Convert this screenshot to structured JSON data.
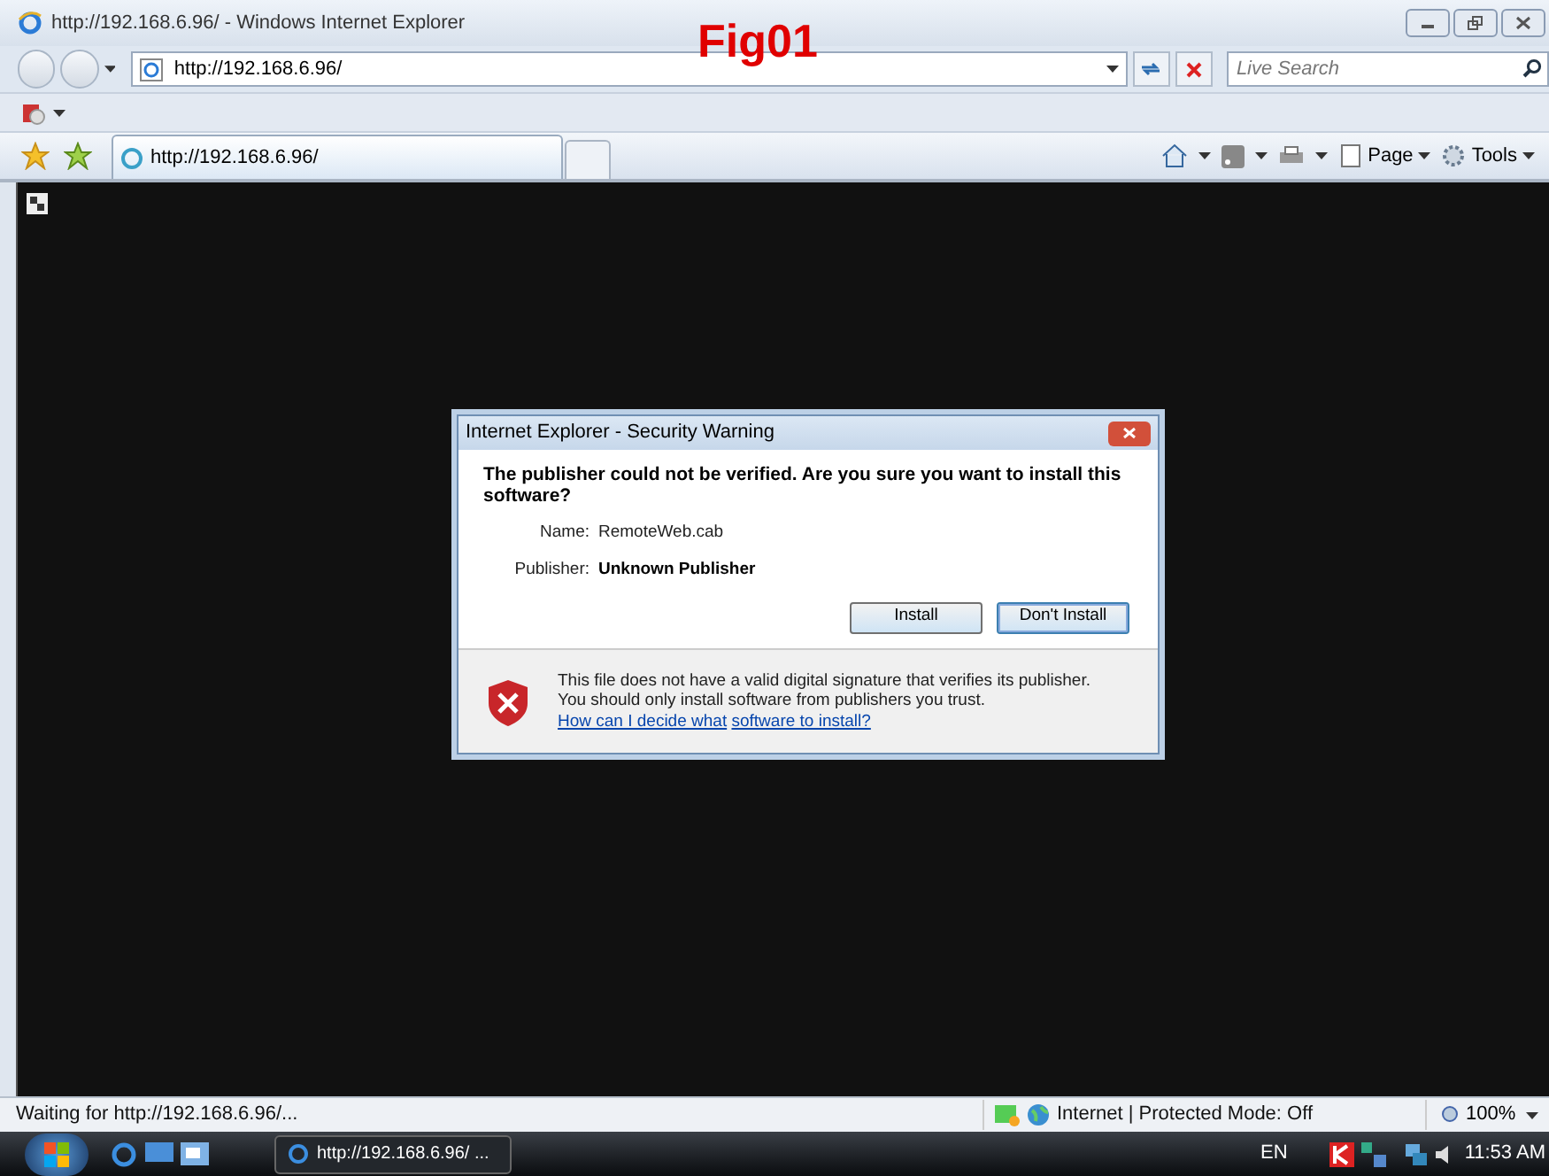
{
  "window": {
    "title": "http://192.168.6.96/ - Windows Internet Explorer"
  },
  "figure_label": "Fig01",
  "address_bar": {
    "url": "http://192.168.6.96/"
  },
  "search": {
    "placeholder": "Live Search"
  },
  "tabs": [
    {
      "label": "http://192.168.6.96/",
      "selected": true
    }
  ],
  "command_bar": [
    {
      "label": "Page"
    },
    {
      "label": "Tools"
    }
  ],
  "dialog": {
    "title": "Internet Explorer - Security Warning",
    "question": "The publisher could not be verified.  Are you sure you want to install this software?",
    "fields": [
      {
        "label": "Name:",
        "value": "RemoteWeb.cab",
        "bold": false
      },
      {
        "label": "Publisher:",
        "value": "Unknown Publisher",
        "bold": true
      }
    ],
    "buttons": [
      {
        "label": "Install",
        "selected": false
      },
      {
        "label": "Don't Install",
        "selected": true
      }
    ],
    "warning": "This file does not have a valid digital signature that verifies its publisher. You should only install software from publishers you trust.",
    "help_link": [
      "How can I decide what",
      "software to install?"
    ]
  },
  "status_bar": {
    "text": "Waiting for http://192.168.6.96/...",
    "zone": "Internet | Protected Mode: Off",
    "zoom": "100%"
  },
  "taskbar": {
    "task": "http://192.168.6.96/ ...",
    "language": "EN",
    "clock": "11:53 AM"
  }
}
